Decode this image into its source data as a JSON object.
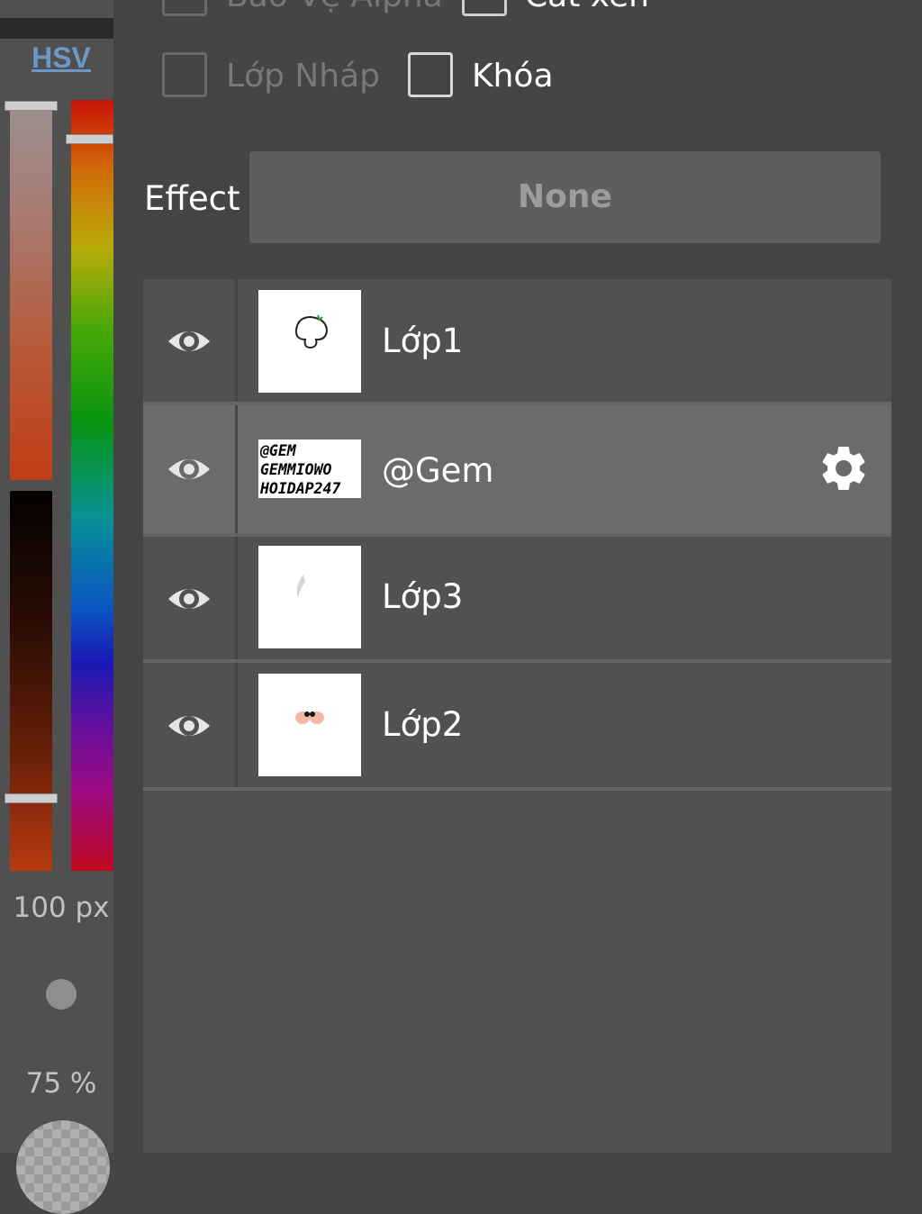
{
  "color_panel": {
    "mode_label": "HSV",
    "size_label": "100 px",
    "opacity_label": "75 %"
  },
  "checkboxes": {
    "alpha_protect": "Bảo Vệ Alpha",
    "clipping": "Cắt xén",
    "draft_layer": "Lớp Nháp",
    "lock": "Khóa"
  },
  "effect": {
    "label": "Effect",
    "value": "None"
  },
  "layers": [
    {
      "name": "Lớp1"
    },
    {
      "name": "@Gem",
      "thumbnail_text": "@GEM\nGEMMIOWO\nHOIDAP247",
      "selected": true
    },
    {
      "name": "Lớp3"
    },
    {
      "name": "Lớp2"
    }
  ],
  "colors": {
    "background": "#454545",
    "panel": "#515151",
    "selected_row": "#6b6b6b",
    "accent_link": "#6b98c4"
  }
}
